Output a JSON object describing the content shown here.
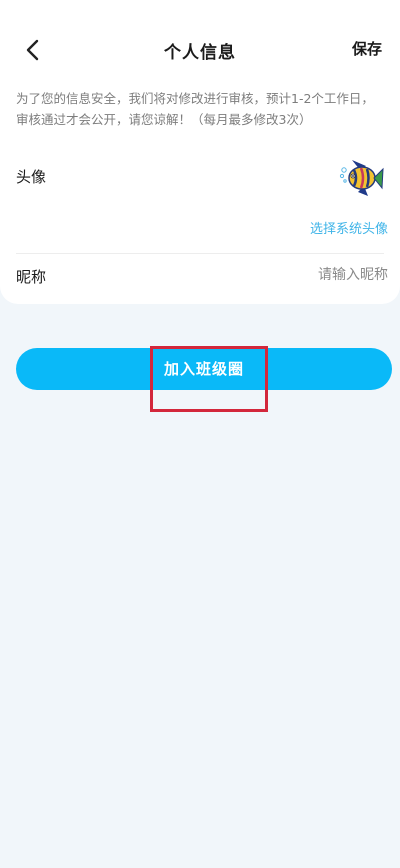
{
  "header": {
    "title": "个人信息",
    "save_label": "保存",
    "back_icon": "chevron-left-icon"
  },
  "notice": {
    "line1": "为了您的信息安全，我们将对修改进行审核，预计1-2个工作日，",
    "line2": "审核通过才会公开，请您谅解！（每月最多修改3次）"
  },
  "avatar_row": {
    "label": "头像",
    "choose_label": "选择系统头像",
    "avatar_icon": "fish-avatar-icon"
  },
  "nickname_row": {
    "label": "昵称",
    "placeholder": "请输入昵称",
    "value": ""
  },
  "join_button": {
    "label": "加入班级圈"
  },
  "colors": {
    "accent": "#0ab9f8",
    "link": "#3fb4e8",
    "background": "#f1f6fa",
    "highlight": "#d3273b"
  }
}
